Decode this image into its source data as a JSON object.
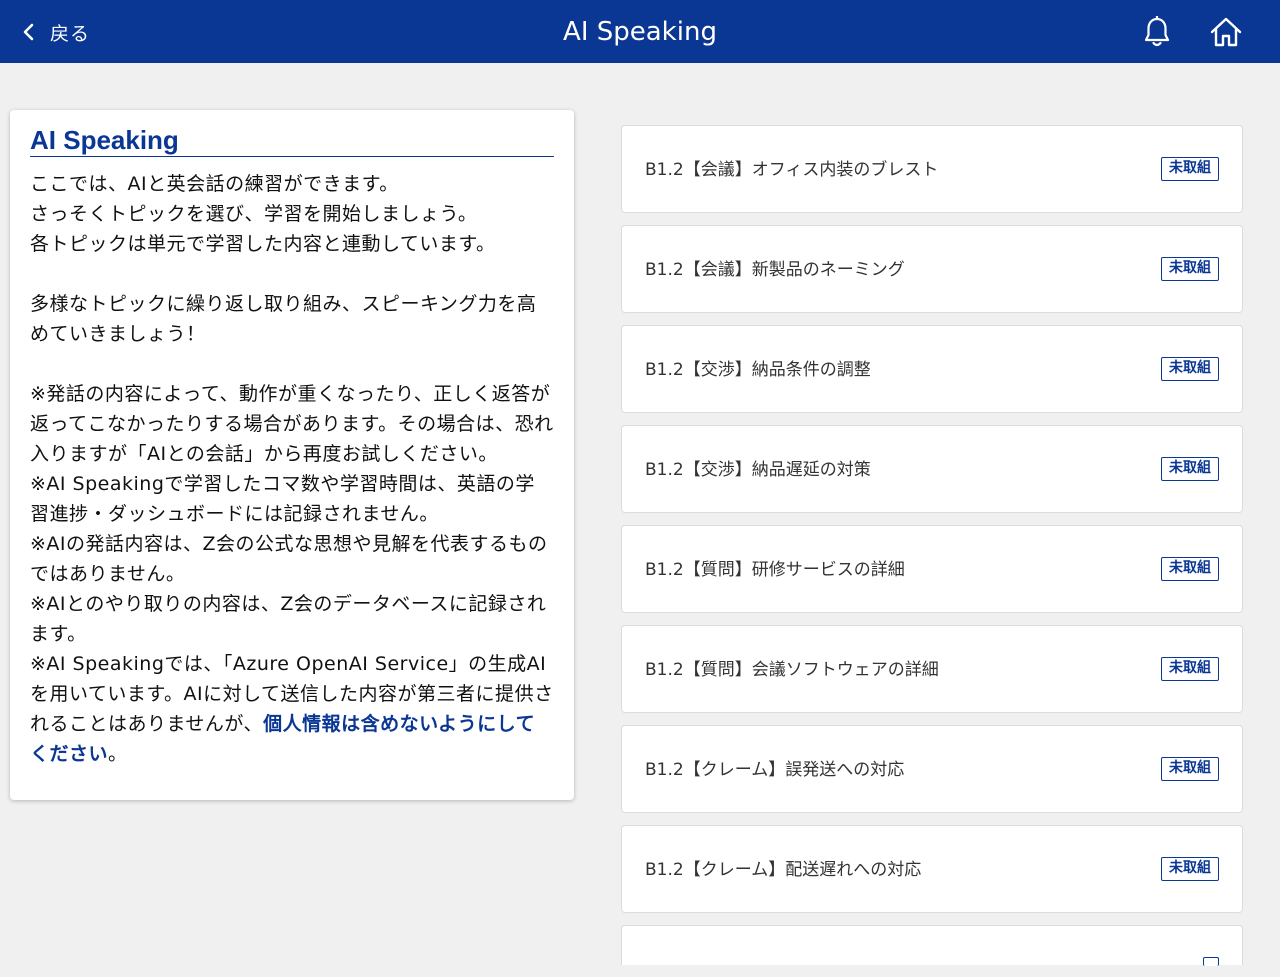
{
  "header": {
    "back_label": "戻る",
    "title": "AI Speaking",
    "bg_color": "#0a3694"
  },
  "info": {
    "title": "AI Speaking",
    "p1": "ここでは、AIと英会話の練習ができます。",
    "p2": "さっそくトピックを選び、学習を開始しましょう。",
    "p3": "各トピックは単元で学習した内容と連動しています。",
    "p4": "多様なトピックに繰り返し取り組み、スピーキング力を高めていきましょう！",
    "p5": "※発話の内容によって、動作が重くなったり、正しく返答が返ってこなかったりする場合があります。その場合は、恐れ入りますが「AIとの会話」から再度お試しください。",
    "p6": "※AI Speakingで学習したコマ数や学習時間は、英語の学習進捗・ダッシュボードには記録されません。",
    "p7": "※AIの発話内容は、Z会の公式な思想や見解を代表するものではありません。",
    "p8": "※AIとのやり取りの内容は、Z会のデータベースに記録されます。",
    "p9": "※AI Speakingでは、「Azure OpenAI Service」の生成AIを用いています。AIに対して送信した内容が第三者に提供されることはありませんが、",
    "p9_emph": "個人情報は含めないようにしてください",
    "p9_end": "。"
  },
  "topics": [
    {
      "label": "B1.2【会議】オフィス内装のブレスト",
      "status": "未取組"
    },
    {
      "label": "B1.2【会議】新製品のネーミング",
      "status": "未取組"
    },
    {
      "label": "B1.2【交渉】納品条件の調整",
      "status": "未取組"
    },
    {
      "label": "B1.2【交渉】納品遅延の対策",
      "status": "未取組"
    },
    {
      "label": "B1.2【質問】研修サービスの詳細",
      "status": "未取組"
    },
    {
      "label": "B1.2【質問】会議ソフトウェアの詳細",
      "status": "未取組"
    },
    {
      "label": "B1.2【クレーム】誤発送への対応",
      "status": "未取組"
    },
    {
      "label": "B1.2【クレーム】配送遅れへの対応",
      "status": "未取組"
    },
    {
      "label": "",
      "status": ""
    }
  ]
}
